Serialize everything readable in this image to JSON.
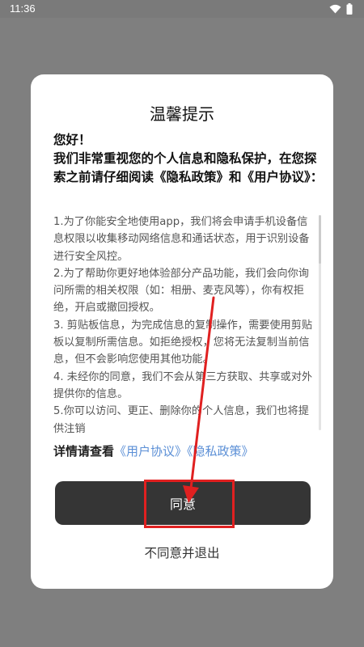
{
  "status_bar": {
    "time": "11:36",
    "icons": [
      "wifi-icon",
      "battery-icon"
    ]
  },
  "dialog": {
    "title": "温馨提示",
    "greeting": "您好！",
    "intro": "我们非常重视您的个人信息和隐私保护，在您探索之前请仔细阅读《隐私政策》和《用户协议》：",
    "terms": [
      "1.为了你能安全地使用app，我们将会申请手机设备信息权限以收集移动网络信息和通话状态，用于识别设备进行安全风控。",
      "2.为了帮助你更好地体验部分产品功能，我们会向你询问所需的相关权限（如：相册、麦克风等），你有权拒绝，开启或撤回授权。",
      "3. 剪贴板信息，为完成信息的复制操作，需要使用剪贴板以复制所需信息。如拒绝授权，您将无法复制当前信息，但不会影响您使用其他功能。",
      "4. 未经你的同意，我们不会从第三方获取、共享或对外提供你的信息。",
      "5.你可以访问、更正、删除你的个人信息，我们也将提供注销"
    ],
    "details_label": "详情请查看",
    "user_agreement_link": "《用户协议》",
    "privacy_policy_link": "《隐私政策》",
    "agree_label": "同意",
    "decline_label": "不同意并退出"
  },
  "colors": {
    "overlay": "#7f7f7f",
    "button": "#353535",
    "link": "#5b8fd6",
    "annotation": "#e02020"
  }
}
